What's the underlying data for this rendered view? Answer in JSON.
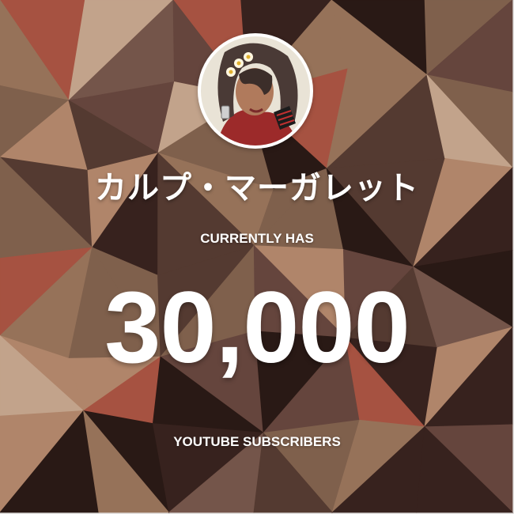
{
  "channel": {
    "name": "カルプ・マーガレット",
    "avatar_icon": "character-portrait-avatar"
  },
  "milestone": {
    "caption_top": "CURRENTLY HAS",
    "count": "30,000",
    "caption_bottom": "YOUTUBE SUBSCRIBERS"
  },
  "colors": {
    "text": "#ffffff",
    "palette": [
      "#8b6a55",
      "#5a3f36",
      "#a57f64",
      "#3a2420",
      "#c39577",
      "#6e4c44",
      "#2a1a16",
      "#b85a48",
      "#d8b79c",
      "#7f5e52"
    ]
  }
}
